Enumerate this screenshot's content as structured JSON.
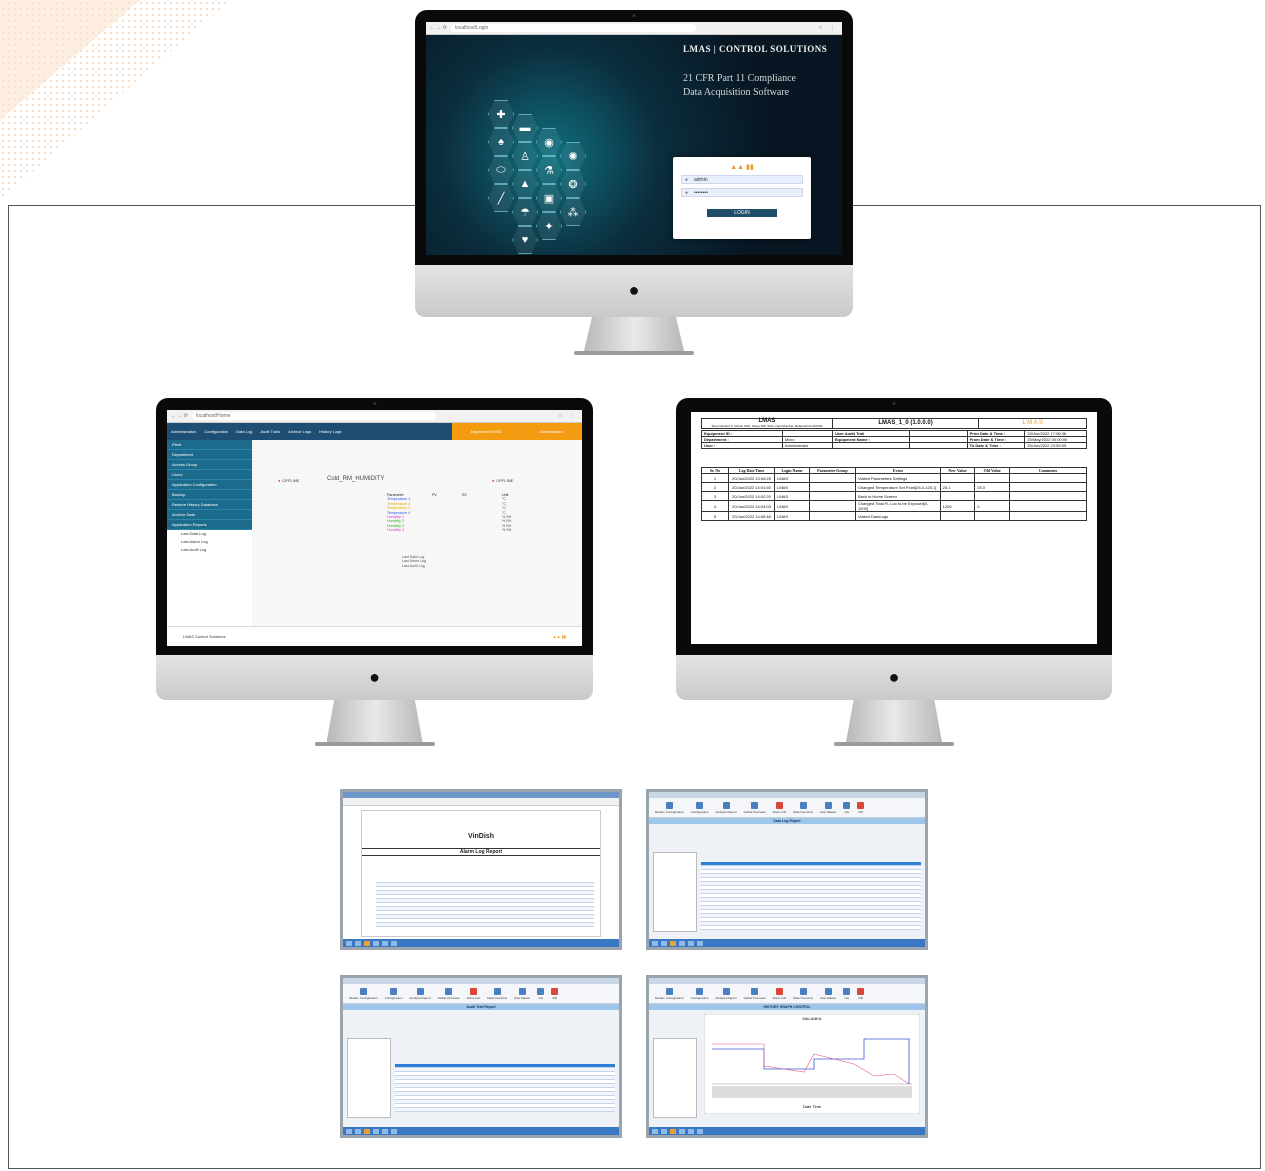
{
  "login_monitor": {
    "url": "localhost/Login",
    "brand": "LMAS | CONTROL SOLUTIONS",
    "tagline_line1": "21 CFR Part 11 Compliance",
    "tagline_line2": "Data Acquisition Software",
    "username": "admin",
    "password": "••••••••",
    "login_button": "LOGIN"
  },
  "dashboard_monitor": {
    "url": "localhost/Home",
    "topnav": [
      "Administration",
      "Configuration",
      "Data Log",
      "Audit Trails",
      "Archive Logs",
      "History Logs"
    ],
    "department": "Department 0001",
    "user": "Administrator",
    "sidebar": [
      "Plant",
      "Department",
      "Access Group",
      "Users",
      "Application Configuration",
      "Backup",
      "Restore History Database",
      "Archive Data",
      "Application Reports"
    ],
    "sidebar_sub": [
      "Last Data Log",
      "Last Alarm Log",
      "Last Audit Log"
    ],
    "panel_title": "Cold_RM_HUMIDITY",
    "status": "OFFLINE",
    "headers": [
      "Parameter",
      "PV",
      "SV",
      "Unit"
    ],
    "params": [
      "Temperature 1",
      "Temperature 2",
      "Temperature 3",
      "Temperature 4",
      "Humidity 1",
      "Humidity 2",
      "Humidity 3",
      "Humidity 4"
    ],
    "units": [
      "°C",
      "°C",
      "°C",
      "°C",
      "% RH",
      "% RH",
      "% RH",
      "% RH"
    ],
    "footer": "LMAS Control Solutions"
  },
  "audit_monitor": {
    "company": "LMAS",
    "address": "Shop Number 5, Ashish CHS, Street 520, Shivi, Navi Mumbai, Maharashtra 400709",
    "app_version": "LMAS_1_0 (1.0.0.0)",
    "report_title": "User Audit Trail",
    "equipment_id_label": "Equipment ID :",
    "department_label": "Department :",
    "department_value": "Micro",
    "user_label": "User :",
    "user_value": "Administrator",
    "equipment_name_label": "Equipment Name :",
    "print_dt_label": "Print Date & Time :",
    "print_dt_value": "20/Jun/2022 17:06:36",
    "from_dt_label": "From Date & Time :",
    "from_dt_value": "20/May/2022 00:00:00",
    "to_dt_label": "To Date & Time :",
    "to_dt_value": "20/Jun/2022 23:59:59",
    "columns": [
      "Sr. No",
      "Log Date Time",
      "Login Name",
      "Parameter Group",
      "Event",
      "New Value",
      "Old Value",
      "Comments"
    ],
    "rows": [
      [
        "1",
        "20/Jun/2022 13:06:25",
        "LMAS",
        "",
        "Visited Parameters Settings",
        "",
        "",
        ""
      ],
      [
        "2",
        "20/Jun/2022 14:01:50",
        "LMAS",
        "",
        "Changed Temperature Set Point[25.0-125.1]",
        "25.1",
        "25.0",
        ""
      ],
      [
        "3",
        "20/Jun/2022 14:02:20",
        "LMAS",
        "",
        "Back to Home Screen",
        "",
        "",
        ""
      ],
      [
        "4",
        "20/Jun/2022 14:04:03",
        "LMAS",
        "",
        "Changed Total FL Lux to be Exposed[0-1200]",
        "1200",
        "0",
        ""
      ],
      [
        "5",
        "20/Jun/2022 14:06:48",
        "LMAS",
        "",
        "Visited DataLogs",
        "",
        "",
        ""
      ]
    ]
  },
  "shots": {
    "alarm": {
      "company": "VinDish",
      "report": "Alarm Log Report"
    },
    "datalog": {
      "report": "Data Log Report"
    },
    "audit": {
      "report": "Audit Trail Report"
    },
    "graph": {
      "report": "HISTORY GRAPH CONTROL",
      "chart_title": "MALANKA",
      "xlabel": "Date Time"
    },
    "toolbar": [
      "Modem Configuration",
      "Configuration",
      "Analysis Report",
      "Global Overview",
      "Alarm Info",
      "Data Overview",
      "User Master",
      "Gis",
      "Pdf",
      "Log Out",
      "admin"
    ]
  }
}
